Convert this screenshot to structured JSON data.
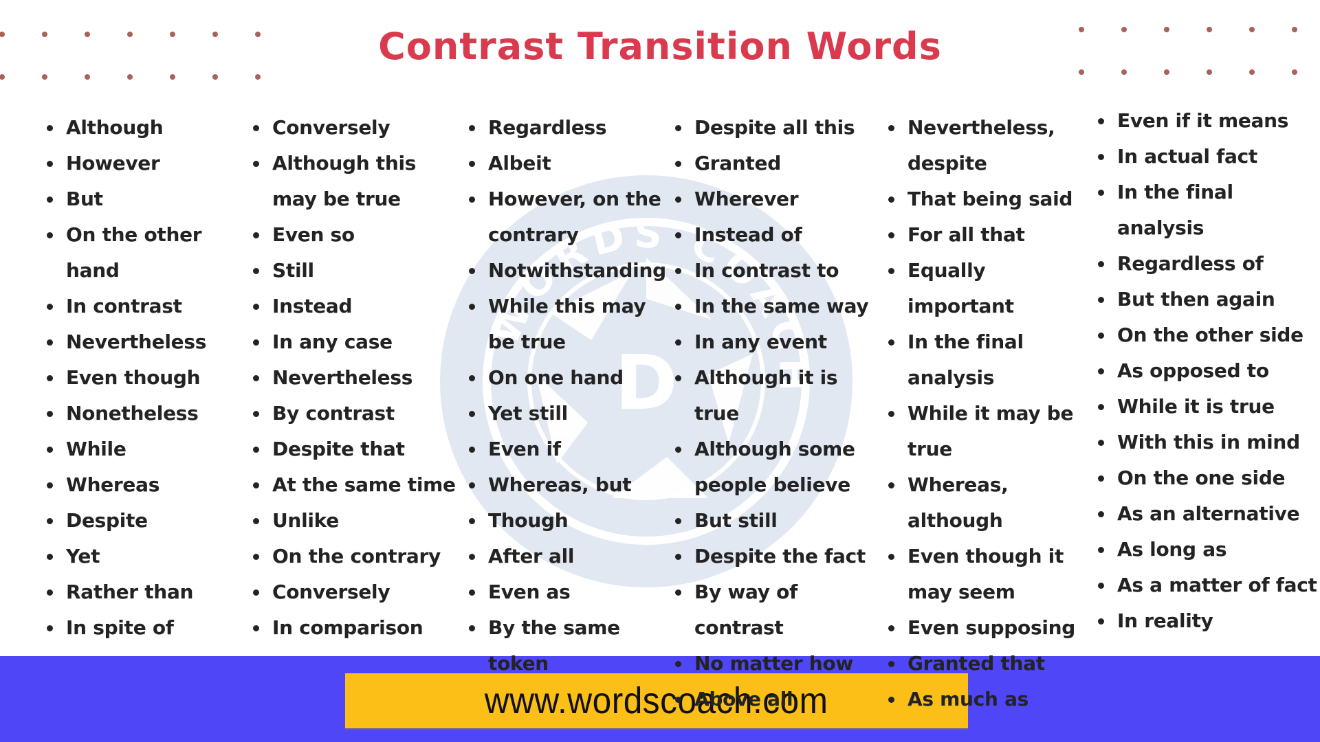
{
  "title": "Contrast Transition Words",
  "colors": {
    "title": "#d93a4e",
    "text": "#232323",
    "dots": "#a8625a",
    "band": "#4f46f7",
    "url_box": "#fbbf17",
    "watermark": "#e2e8f2"
  },
  "watermark": {
    "icon": "words-coach-logo",
    "text": "WORDS COACH",
    "letter": "D"
  },
  "columns": [
    {
      "items": [
        "Although",
        "However",
        "But",
        "On the other hand",
        "In contrast",
        "Nevertheless",
        "Even though",
        "Nonetheless",
        "While",
        "Whereas",
        "Despite",
        "Yet",
        "Rather than",
        "In spite of"
      ]
    },
    {
      "items": [
        "Conversely",
        "Although this may be true",
        "Even so",
        "Still",
        "Instead",
        "In any case",
        "Nevertheless",
        "By contrast",
        "Despite that",
        "At the same time",
        "Unlike",
        "On the contrary",
        "Conversely",
        "In comparison"
      ]
    },
    {
      "items": [
        "Regardless",
        "Albeit",
        "However, on the contrary",
        "Notwithstanding",
        "While this may be true",
        "On one hand",
        "Yet still",
        "Even if",
        "Whereas, but",
        "Though",
        "After all",
        "Even as",
        "By the same token"
      ]
    },
    {
      "items": [
        "Despite all this",
        "Granted",
        "Wherever",
        "Instead of",
        "In contrast to",
        "In the same way",
        "In any event",
        "Although it is true",
        "Although some people believe",
        "But still",
        "Despite the fact",
        "By way of contrast",
        "No matter how",
        "Above all"
      ]
    },
    {
      "items": [
        "Nevertheless, despite",
        "That being said",
        "For all that",
        "Equally important",
        "In the final analysis",
        "While it may be true",
        "Whereas, although",
        "Even though it may seem",
        "Even supposing",
        "Granted that",
        "As much as"
      ]
    },
    {
      "items": [
        "Even if it means",
        "In actual fact",
        "In the final analysis",
        "Regardless of",
        "But then again",
        "On the other side",
        "As opposed to",
        "While it is true",
        "With this in mind",
        "On the one side",
        "As an alternative",
        "As long as",
        "As a matter of fact",
        "In reality"
      ]
    }
  ],
  "footer": {
    "url": "www.wordscoach.com"
  }
}
